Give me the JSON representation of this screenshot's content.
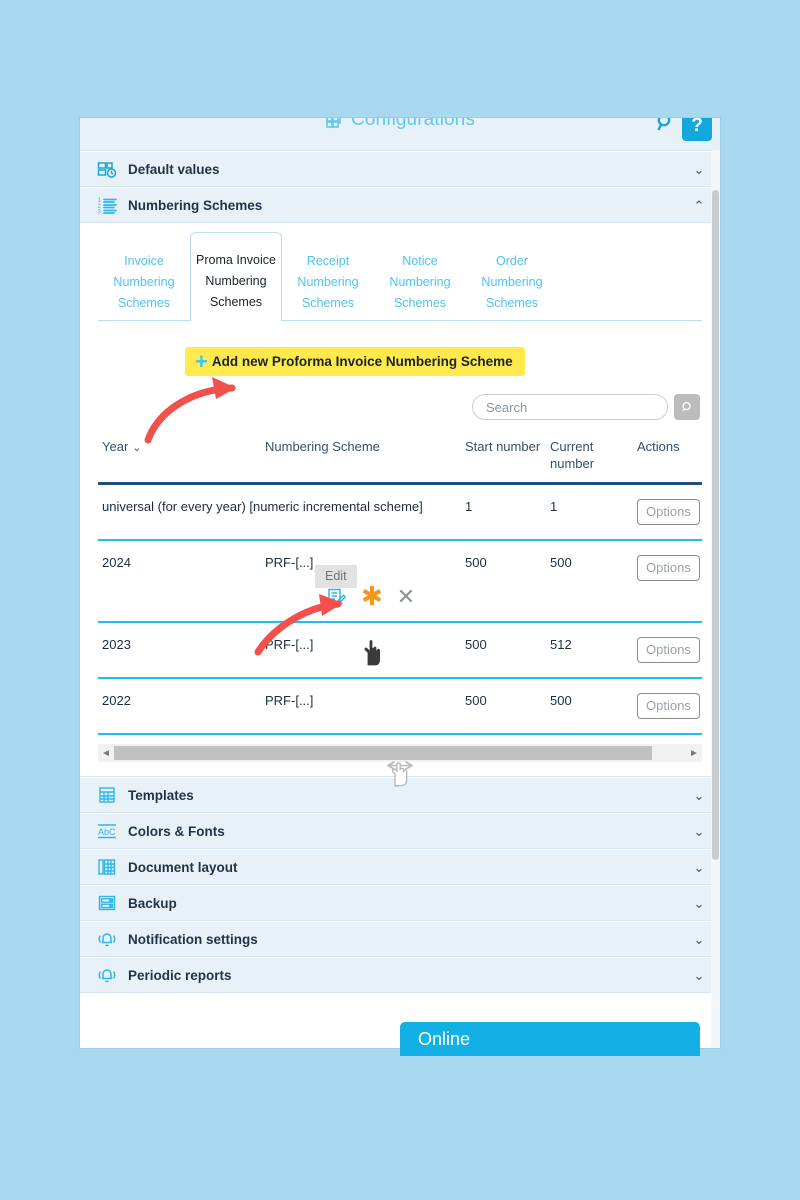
{
  "window": {
    "title": "Configurations",
    "title_icon": "configurations-grid-icon",
    "search_icon": "magnifier-icon",
    "help_label": "?"
  },
  "accordion_top": [
    {
      "label": "Default values",
      "icon": "default-values-icon",
      "chevron": "⌄",
      "expanded": false
    },
    {
      "label": "Numbering Schemes",
      "icon": "numbered-list-icon",
      "chevron": "⌃",
      "expanded": true
    }
  ],
  "accordion_bottom": [
    {
      "label": "Templates",
      "icon": "templates-grid-icon",
      "chevron": "⌄"
    },
    {
      "label": "Colors & Fonts",
      "icon": "abc-font-icon",
      "chevron": "⌄"
    },
    {
      "label": "Document layout",
      "icon": "document-layout-icon",
      "chevron": "⌄"
    },
    {
      "label": "Backup",
      "icon": "backup-drive-icon",
      "chevron": "⌄"
    },
    {
      "label": "Notification settings",
      "icon": "bell-icon",
      "chevron": "⌄"
    },
    {
      "label": "Periodic reports",
      "icon": "bell-icon",
      "chevron": "⌄"
    }
  ],
  "tabs": [
    {
      "label": "Invoice Numbering Schemes",
      "active": false
    },
    {
      "label": "Proma Invoice Numbering Schemes",
      "active": true
    },
    {
      "label": "Receipt Numbering Schemes",
      "active": false
    },
    {
      "label": "Notice Numbering Schemes",
      "active": false
    },
    {
      "label": "Order Numbering Schemes",
      "active": false
    }
  ],
  "add_button": {
    "plus": "+",
    "label": "Add new Proforma Invoice Numbering Scheme"
  },
  "search": {
    "value": "",
    "placeholder": "Search",
    "submit_icon": "magnifier-icon"
  },
  "table": {
    "headers": {
      "year": "Year",
      "year_sort_caret": "⌄",
      "scheme": "Numbering Scheme",
      "start": "Start number",
      "current": "Current number",
      "actions": "Actions"
    },
    "rows": [
      {
        "year": "universal (for every year) [numeric incremental scheme]",
        "scheme": "",
        "start": "1",
        "current": "1",
        "actions": "Options",
        "universal": true
      },
      {
        "year": "2024",
        "scheme": "PRF-[...]",
        "start": "500",
        "current": "500",
        "actions": "Options",
        "universal": false
      },
      {
        "year": "2023",
        "scheme": "PRF-[...]",
        "start": "500",
        "current": "512",
        "actions": "Options",
        "universal": false
      },
      {
        "year": "2022",
        "scheme": "PRF-[...]",
        "start": "500",
        "current": "500",
        "actions": "Options",
        "universal": false
      }
    ]
  },
  "row_actions": {
    "tooltip": "Edit",
    "edit_icon": "edit-document-icon",
    "star_icon": "asterisk-star-icon",
    "star_glyph": "✱",
    "delete_icon": "close-x-icon",
    "delete_glyph": "✕"
  },
  "hscroll": {
    "left_arrow": "◄",
    "right_arrow": "►"
  },
  "online_bar": {
    "label": "Online"
  },
  "colors": {
    "page_background": "#a8d8ef",
    "panel_background": "#e9f1f8",
    "accent_cyan": "#1fbdf0",
    "tab_link": "#4ec3ee",
    "highlight_yellow": "#ffe94d",
    "annotation_red": "#f2504b",
    "star_orange": "#f7941d",
    "header_rule_navy": "#1f4e79",
    "online_blue": "#13b0e6"
  }
}
